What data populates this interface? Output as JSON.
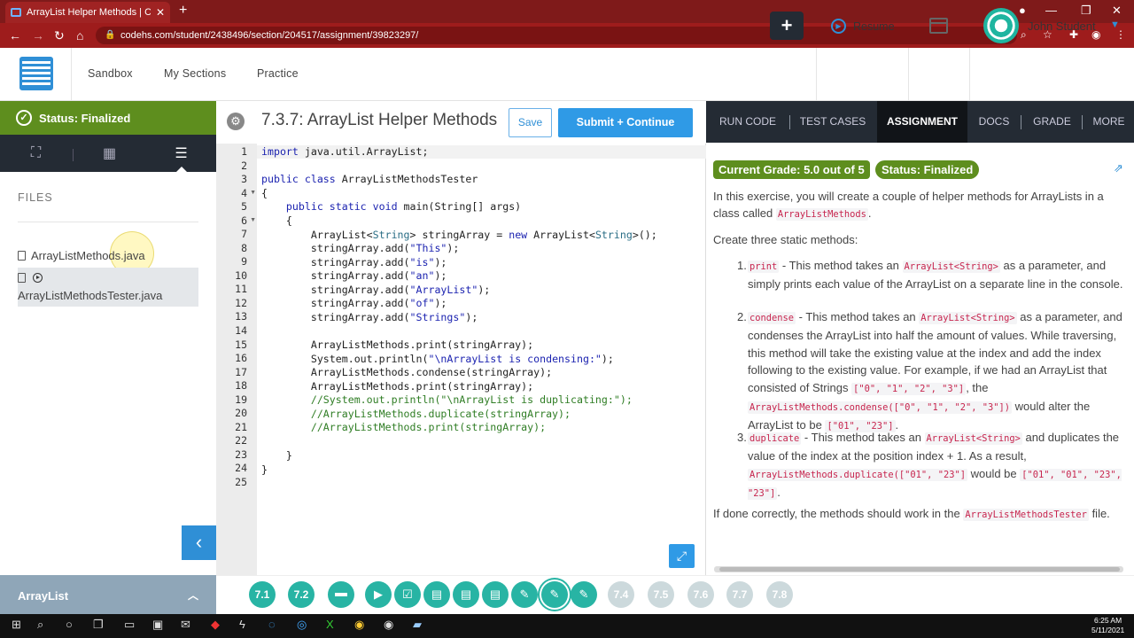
{
  "browser": {
    "tab_title": "ArrayList Helper Methods | Code",
    "url": "codehs.com/student/2438496/section/204517/assignment/39823297/"
  },
  "header": {
    "nav": [
      "Sandbox",
      "My Sections",
      "Practice"
    ],
    "plus": "+",
    "resume": "Resume",
    "user_name": "John Student"
  },
  "sidebar": {
    "status": "Status: Finalized",
    "files_label": "FILES",
    "files": [
      "ArrayListMethods.java",
      "ArrayListMethodsTester.java"
    ],
    "chapter": "ArrayList"
  },
  "editor": {
    "title": "7.3.7: ArrayList Helper Methods",
    "save_label": "Save",
    "submit_label": "Submit + Continue",
    "line_numbers": [
      "1",
      "2",
      "3",
      "4",
      "5",
      "6",
      "7",
      "8",
      "9",
      "10",
      "11",
      "12",
      "13",
      "14",
      "15",
      "16",
      "17",
      "18",
      "19",
      "20",
      "21",
      "22",
      "23",
      "24",
      "25"
    ]
  },
  "right_panel": {
    "tabs": [
      "RUN CODE",
      "TEST CASES",
      "ASSIGNMENT",
      "DOCS",
      "GRADE",
      "MORE"
    ],
    "grade": "Current Grade: 5.0 out of 5",
    "status": "Status: Finalized",
    "intro_1": "In this exercise, you will create a couple of helper methods for ArrayLists in a class called",
    "intro_code": "ArrayListMethods",
    "intro_end": ".",
    "create": "Create three static methods:",
    "items": [
      {
        "num": "1.",
        "code": "print",
        "t1": " - This method takes an ",
        "c2": "ArrayList<String>",
        "t2": " as a parameter, and simply prints each value of the ArrayList on a separate line in the console."
      },
      {
        "num": "2.",
        "code": "condense",
        "t1": " - This method takes an ",
        "c2": "ArrayList<String>",
        "t2": " as a parameter, and condenses the ArrayList into half the amount of values. While traversing, this method will take the existing value at the index and add the index following to the existing value. For example, if we had an ArrayList that consisted of Strings ",
        "c3": "[\"0\", \"1\", \"2\", \"3\"]",
        "t3": ", the ",
        "c4": "ArrayListMethods.condense([\"0\", \"1\", \"2\", \"3\"])",
        "t4": " would alter the ArrayList to be ",
        "c5": "[\"01\", \"23\"]",
        "t5": "."
      },
      {
        "num": "3.",
        "code": "duplicate",
        "t1": " - This method takes an ",
        "c2": "ArrayList<String>",
        "t2": " and duplicates the value of the index at the position index + 1. As a result, ",
        "c3": "ArrayListMethods.duplicate([\"01\", \"23\"]",
        "t3": " would be ",
        "c4": "[\"01\", \"01\", \"23\", \"23\"]",
        "t4": "."
      }
    ],
    "outro": "If done correctly, the methods should work in the",
    "outro_code": "ArrayListMethodsTester",
    "outro_end": " file."
  },
  "progress": {
    "lessons_before": [
      "7.1",
      "7.2"
    ],
    "lessons_after": [
      "7.4",
      "7.5",
      "7.6",
      "7.7",
      "7.8"
    ]
  },
  "taskbar": {
    "time": "6:25 AM",
    "date": "5/11/2021"
  },
  "colors": {
    "status_green": "#5e8e1e",
    "accent_blue": "#2f9ae6",
    "teal": "#28b4a4",
    "dark": "#242b34"
  }
}
